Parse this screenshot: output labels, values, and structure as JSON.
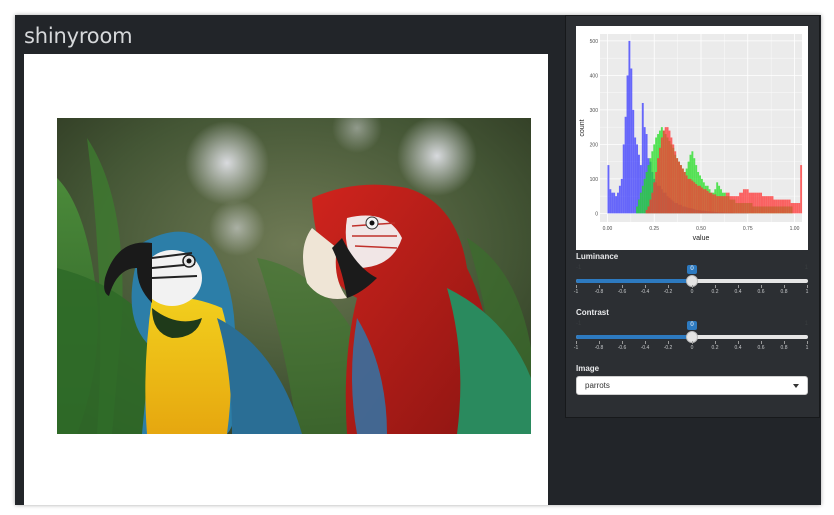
{
  "app": {
    "title": "shinyroom"
  },
  "main": {
    "image": {
      "subject": "parrots"
    }
  },
  "sidebar": {
    "histogram": {
      "chart_data": {
        "type": "histogram",
        "xlabel": "value",
        "ylabel": "count",
        "xlim": [
          0,
          1
        ],
        "ylim": [
          0,
          520
        ],
        "x_ticks": [
          "0.00",
          "0.25",
          "0.50",
          "0.75",
          "1.00"
        ],
        "y_ticks": [
          "0",
          "100",
          "200",
          "300",
          "400",
          "500"
        ],
        "bin_width": 0.0102,
        "bins_start": 0.0,
        "series": [
          {
            "color": "#3a3aff",
            "values": [
              140,
              70,
              60,
              60,
              50,
              60,
              80,
              100,
              200,
              280,
              400,
              500,
              420,
              300,
              220,
              200,
              170,
              140,
              320,
              250,
              230,
              160,
              150,
              120,
              100,
              90,
              80,
              80,
              70,
              60,
              60,
              50,
              45,
              40,
              35,
              30,
              30,
              25,
              25,
              20,
              20,
              18,
              16,
              15,
              14,
              12,
              10,
              10,
              9,
              8,
              8,
              7,
              6,
              6,
              5,
              5,
              4,
              4,
              3,
              3,
              3,
              2,
              2,
              2,
              2,
              2,
              1,
              1,
              1,
              1,
              1,
              1,
              1,
              1,
              0,
              0,
              0,
              0,
              0,
              0,
              0,
              0,
              0,
              0,
              0,
              0,
              0,
              0,
              0,
              0,
              0,
              0,
              0,
              0,
              0,
              0,
              0,
              0
            ]
          },
          {
            "color": "#22dd22",
            "values": [
              0,
              0,
              0,
              0,
              0,
              0,
              0,
              0,
              0,
              0,
              0,
              0,
              0,
              0,
              0,
              20,
              40,
              60,
              80,
              100,
              120,
              140,
              160,
              180,
              200,
              220,
              230,
              240,
              250,
              240,
              230,
              220,
              210,
              200,
              190,
              170,
              160,
              150,
              140,
              130,
              120,
              130,
              150,
              170,
              180,
              160,
              140,
              120,
              110,
              100,
              90,
              80,
              80,
              70,
              60,
              60,
              70,
              90,
              80,
              70,
              60,
              60,
              50,
              50,
              40,
              40,
              40,
              30,
              30,
              30,
              30,
              30,
              30,
              30,
              30,
              30,
              20,
              20,
              20,
              20,
              20,
              20,
              20,
              20,
              20,
              20,
              20,
              20,
              20,
              20,
              20,
              20,
              20,
              20,
              20,
              20,
              20
            ]
          },
          {
            "color": "#ff3333",
            "values": [
              0,
              0,
              0,
              0,
              0,
              0,
              0,
              0,
              0,
              0,
              0,
              0,
              0,
              0,
              0,
              0,
              0,
              0,
              0,
              0,
              10,
              20,
              40,
              60,
              90,
              120,
              160,
              190,
              220,
              240,
              250,
              250,
              240,
              220,
              200,
              180,
              160,
              150,
              140,
              130,
              120,
              110,
              100,
              100,
              95,
              90,
              85,
              80,
              80,
              75,
              70,
              70,
              65,
              60,
              60,
              55,
              55,
              50,
              50,
              50,
              50,
              50,
              60,
              60,
              50,
              50,
              50,
              50,
              50,
              60,
              60,
              70,
              70,
              70,
              60,
              60,
              60,
              60,
              60,
              60,
              60,
              50,
              50,
              50,
              50,
              50,
              50,
              40,
              40,
              40,
              40,
              40,
              40,
              40,
              40,
              40,
              30,
              30,
              30,
              30,
              30,
              140
            ]
          }
        ]
      }
    },
    "luminance": {
      "label": "Luminance",
      "value": "0",
      "value_num": 0,
      "min": "-1",
      "max": "1",
      "ticks": [
        "-1",
        "-0.8",
        "-0.6",
        "-0.4",
        "-0.2",
        "0",
        "0.2",
        "0.4",
        "0.6",
        "0.8",
        "1"
      ]
    },
    "contrast": {
      "label": "Contrast",
      "value": "0",
      "value_num": 0,
      "min": "-1",
      "max": "1",
      "ticks": [
        "-1",
        "-0.8",
        "-0.6",
        "-0.4",
        "-0.2",
        "0",
        "0.2",
        "0.4",
        "0.6",
        "0.8",
        "1"
      ]
    },
    "image": {
      "label": "Image",
      "selected": "parrots"
    }
  },
  "colors": {
    "app_bg": "#222529",
    "sidebar_bg": "#2c2f33",
    "slider_accent": "#2d7ac0"
  }
}
